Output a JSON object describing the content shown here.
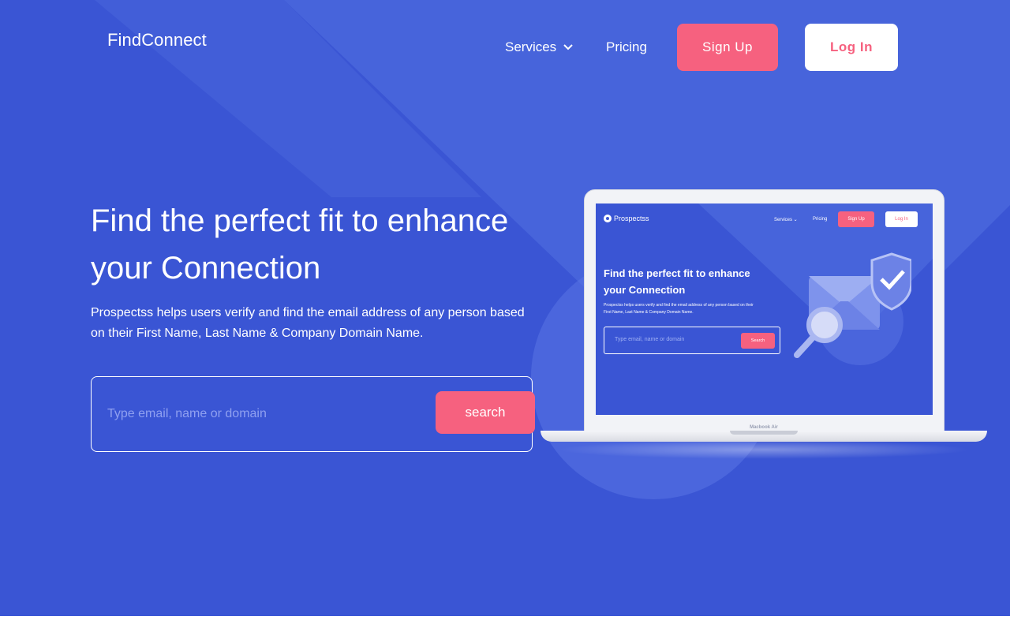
{
  "brand": {
    "name": "FindConnect"
  },
  "nav": {
    "services_label": "Services",
    "pricing_label": "Pricing",
    "signup_label": "Sign Up",
    "login_label": "Log In"
  },
  "hero": {
    "headline": "Find the perfect fit to enhance your Connection",
    "subtext": "Prospectss helps users verify and find the email address of any person based on their First Name, Last Name & Company Domain Name.",
    "search_placeholder": "Type email, name or domain",
    "search_button_label": "search"
  },
  "mockup": {
    "logo": "Prospectss",
    "nav_services": "Services",
    "nav_pricing": "Pricing",
    "signup": "Sign Up",
    "login": "Log In",
    "headline": "Find the perfect fit to enhance your Connection",
    "subtext": "Prospectss helps users verify and find the email address of any person based on their First Name, Last Name & Company Domain Name.",
    "search_placeholder": "Type email, name or domain",
    "search_button": "Search",
    "device_label": "Macbook Air"
  },
  "colors": {
    "hero_bg": "#3A55D4",
    "accent": "#F6617F",
    "white": "#FFFFFF"
  },
  "icons": {
    "services_dropdown": "chevron-down-icon",
    "mockup_illustration": "envelope-search-shield-icon"
  }
}
